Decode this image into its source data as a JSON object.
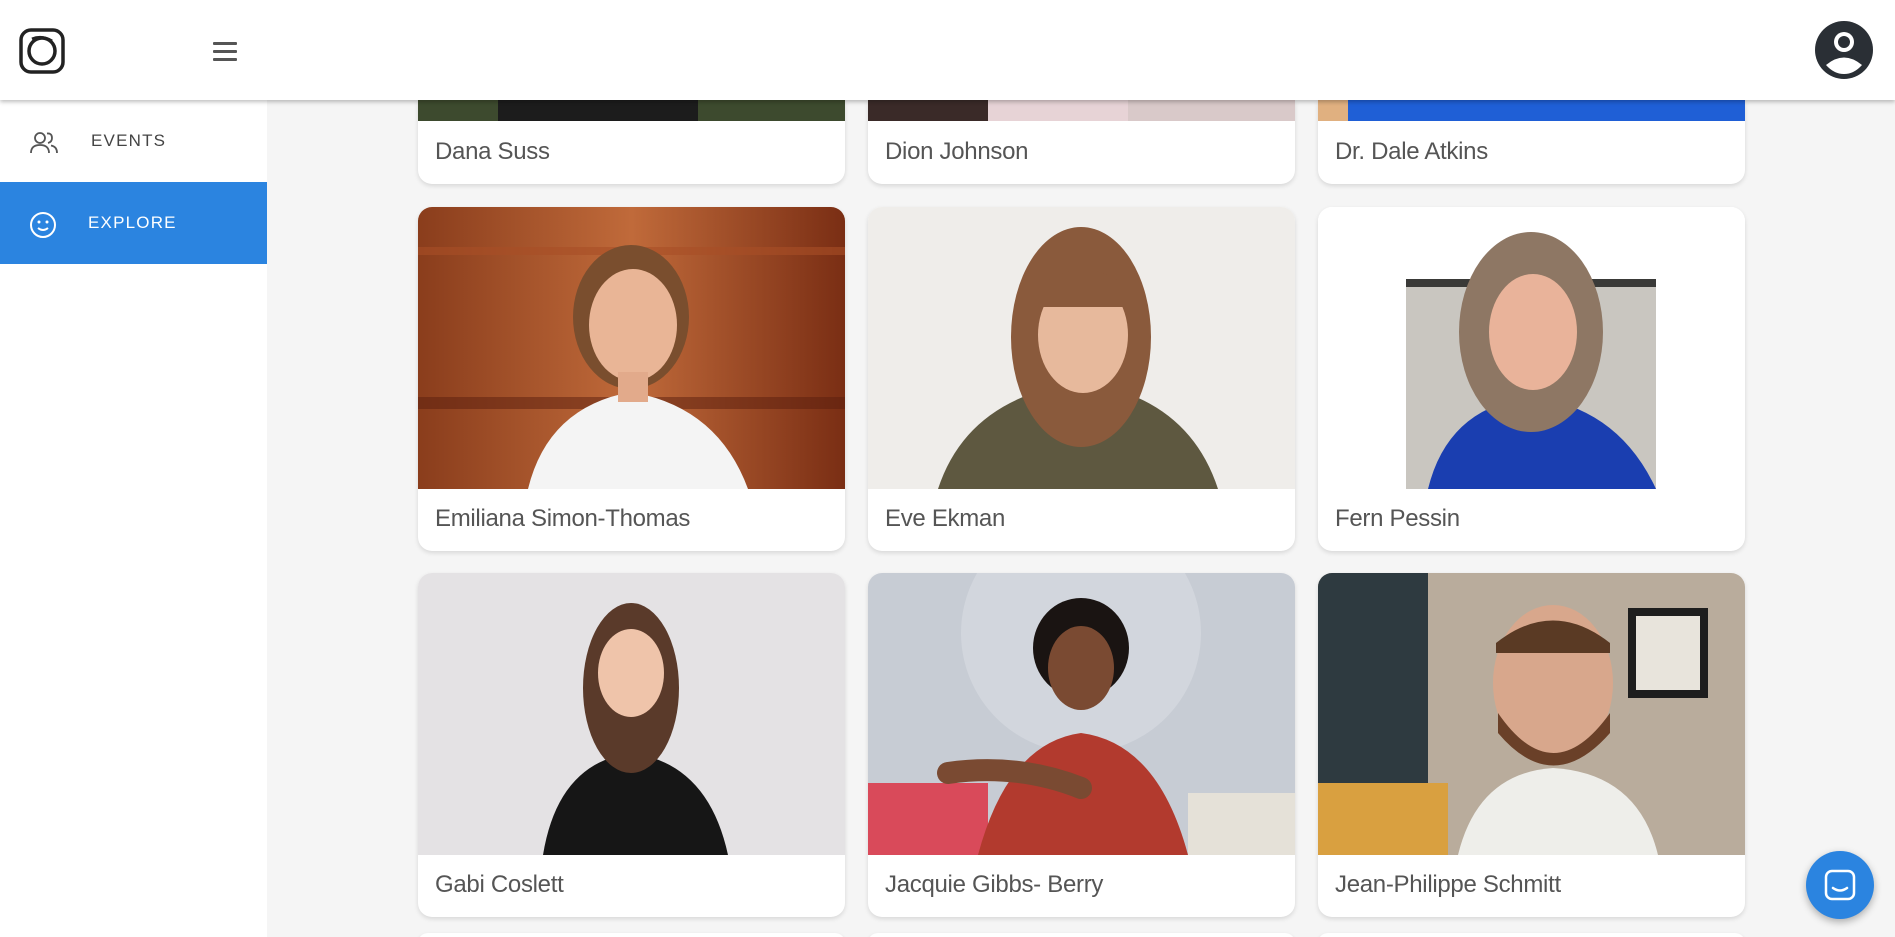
{
  "nav": {
    "items": [
      {
        "label": "EVENTS",
        "icon": "people-icon",
        "active": false
      },
      {
        "label": "EXPLORE",
        "icon": "smiley-icon",
        "active": true
      }
    ]
  },
  "colors": {
    "accent": "#2b84e0",
    "text": "#555555",
    "background": "#f5f5f5"
  },
  "people": [
    {
      "name": "Dana Suss"
    },
    {
      "name": "Dion Johnson"
    },
    {
      "name": "Dr. Dale Atkins"
    },
    {
      "name": "Emiliana Simon-Thomas"
    },
    {
      "name": "Eve Ekman"
    },
    {
      "name": "Fern Pessin"
    },
    {
      "name": "Gabi Coslett"
    },
    {
      "name": "Jacquie Gibbs- Berry"
    },
    {
      "name": "Jean-Philippe Schmitt"
    }
  ]
}
